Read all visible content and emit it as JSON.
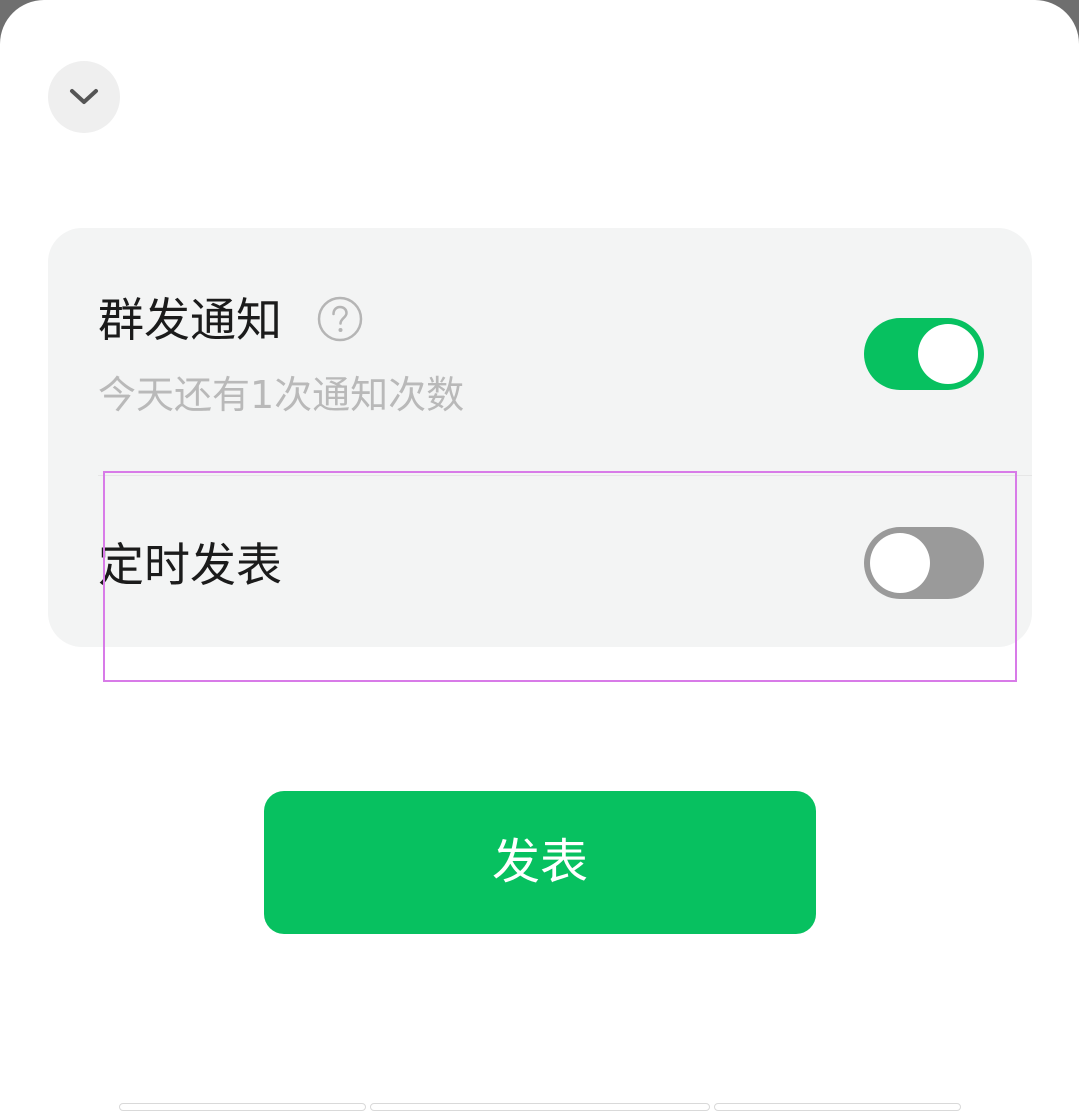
{
  "colors": {
    "accent": "#07c160",
    "toggle_off": "#9a9a9a",
    "card_bg": "#f3f4f4",
    "subtext": "#b9b9b9",
    "highlight": "#d87be8"
  },
  "header": {
    "collapse_icon": "chevron-down-icon"
  },
  "settings": {
    "group_notify": {
      "label": "群发通知",
      "help_icon": "question-circle-icon",
      "subtitle": "今天还有1次通知次数",
      "enabled": true
    },
    "scheduled_post": {
      "label": "定时发表",
      "enabled": false
    }
  },
  "actions": {
    "publish_label": "发表"
  }
}
